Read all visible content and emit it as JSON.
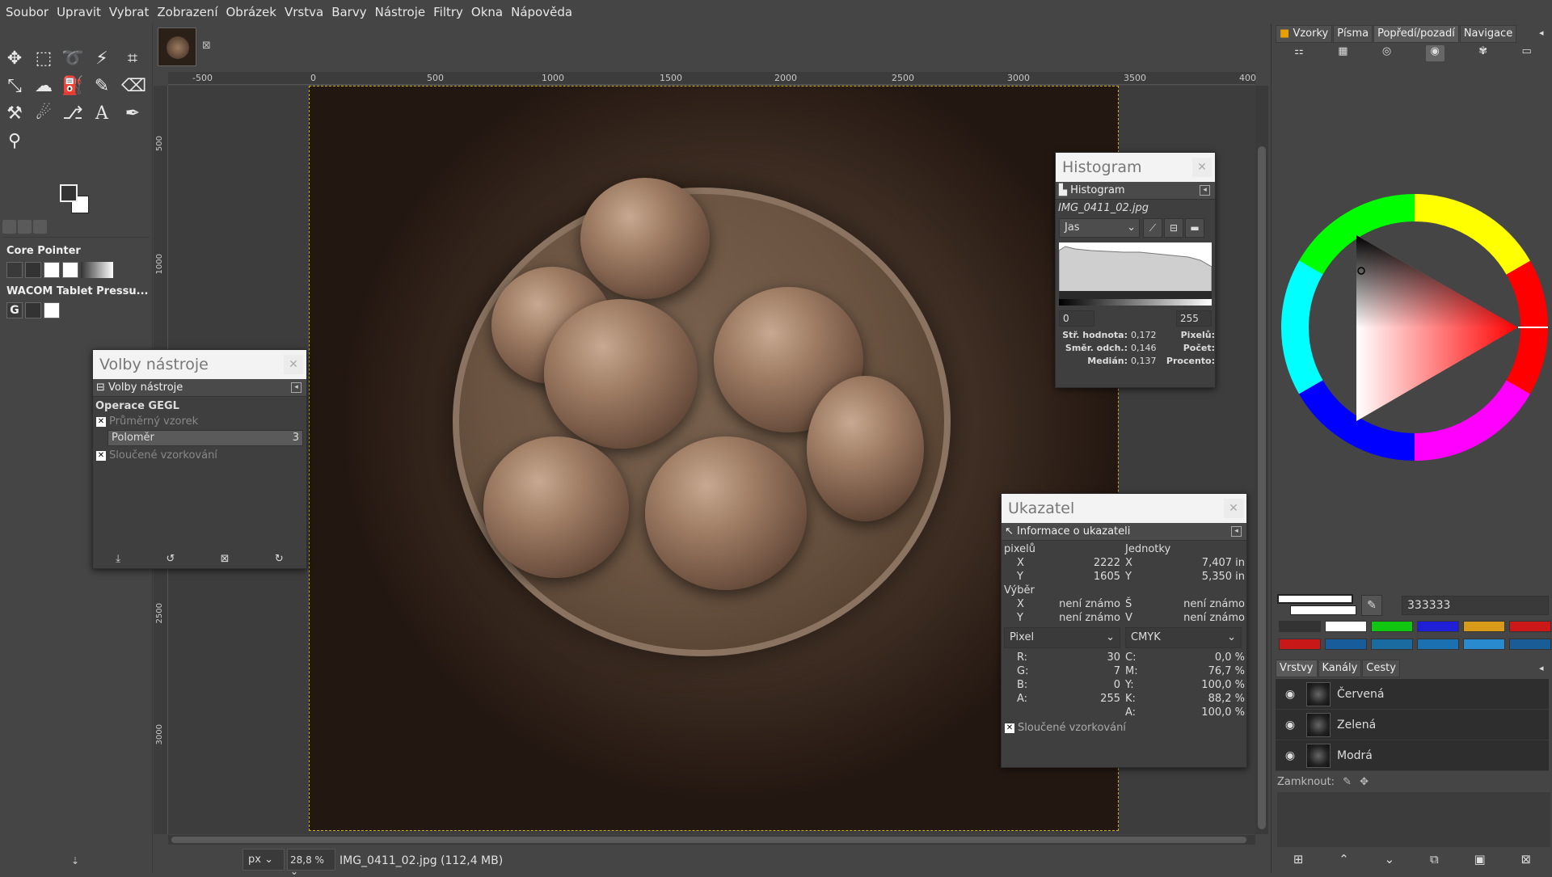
{
  "menu": [
    "Soubor",
    "Upravit",
    "Vybrat",
    "Zobrazení",
    "Obrázek",
    "Vrstva",
    "Barvy",
    "Nástroje",
    "Filtry",
    "Okna",
    "Nápověda"
  ],
  "toolbox": {
    "tools": [
      "move-icon",
      "rect-select-icon",
      "lasso-icon",
      "fuzzy-select-icon",
      "crop-icon",
      "transform-icon",
      "warp-icon",
      "bucket-fill-icon",
      "paintbrush-icon",
      "eraser-icon",
      "clone-icon",
      "smudge-icon",
      "paths-icon",
      "text-icon",
      "color-picker-icon",
      "zoom-icon"
    ],
    "fg_color": "#333333",
    "bg_color": "#ffffff",
    "devices": [
      {
        "name": "Core Pointer"
      },
      {
        "name": "WACOM Tablet Pressu..."
      }
    ]
  },
  "image_tab": {
    "close_glyph": "⊠"
  },
  "ruler_h": [
    "-500",
    "0",
    "500",
    "1000",
    "1500",
    "2000",
    "2500",
    "3000",
    "3500",
    "400"
  ],
  "ruler_v": [
    "500",
    "1000",
    "2500",
    "3000"
  ],
  "status": {
    "unit": "px",
    "zoom": "28,8 %",
    "info": "IMG_0411_02.jpg (112,4 MB)"
  },
  "tool_options": {
    "window_title": "Volby nástroje",
    "header": "Volby nástroje",
    "section": "Operace GEGL",
    "sample_average": "Průměrný vzorek",
    "radius_label": "Poloměr",
    "radius_value": "3",
    "sample_merged": "Sloučené vzorkování"
  },
  "histogram": {
    "window_title": "Histogram",
    "header": "Histogram",
    "image_name": "IMG_0411_02.jpg",
    "channel": "Jas",
    "range_min": "0",
    "range_max": "255",
    "mean_label": "Stř. hodnota:",
    "mean_value": "0,172",
    "stddev_label": "Směr. odch.:",
    "stddev_value": "0,146",
    "median_label": "Medián:",
    "median_value": "0,137",
    "pixels_label": "Pixelů:",
    "count_label": "Počet:",
    "percent_label": "Procento:"
  },
  "pointer": {
    "window_title": "Ukazatel",
    "header": "Informace o ukazateli",
    "pixels_label": "pixelů",
    "units_label": "Jednotky",
    "x_label": "X",
    "y_label": "Y",
    "x_px": "2222",
    "y_px": "1605",
    "x_in": "7,407 in",
    "y_in": "5,350 in",
    "selection_label": "Výběr",
    "w_label": "Š",
    "h_label": "V",
    "unknown": "není známo",
    "mode_left": "Pixel",
    "mode_right": "CMYK",
    "r_label": "R:",
    "r": "30",
    "g_label": "G:",
    "g": "7",
    "b_label": "B:",
    "b": "0",
    "a_label": "A:",
    "a": "255",
    "c_label": "C:",
    "c": "0,0 %",
    "m_label": "M:",
    "m": "76,7 %",
    "yy_label": "Y:",
    "yy": "100,0 %",
    "k_label": "K:",
    "k": "88,2 %",
    "a2_label": "A:",
    "a2": "100,0 %",
    "sample_merged": "Sloučené vzorkování"
  },
  "right_dock": {
    "tabs": [
      "Vzorky",
      "Písma",
      "Popředí/pozadí",
      "Navigace"
    ],
    "hex": "333333",
    "swatches_row1": [
      "#333333",
      "#ffffff",
      "#11c611",
      "#1f1fd8",
      "#d99a1a",
      "#cc1818"
    ],
    "swatches_row2": [
      "#c81818",
      "#185c9c",
      "#1a6ca0",
      "#1a70b0",
      "#2a8ad0",
      "#1a5c96"
    ],
    "layer_tabs": [
      "Vrstvy",
      "Kanály",
      "Cesty"
    ],
    "channels": [
      "Červená",
      "Zelená",
      "Modrá"
    ],
    "lock_label": "Zamknout:"
  }
}
